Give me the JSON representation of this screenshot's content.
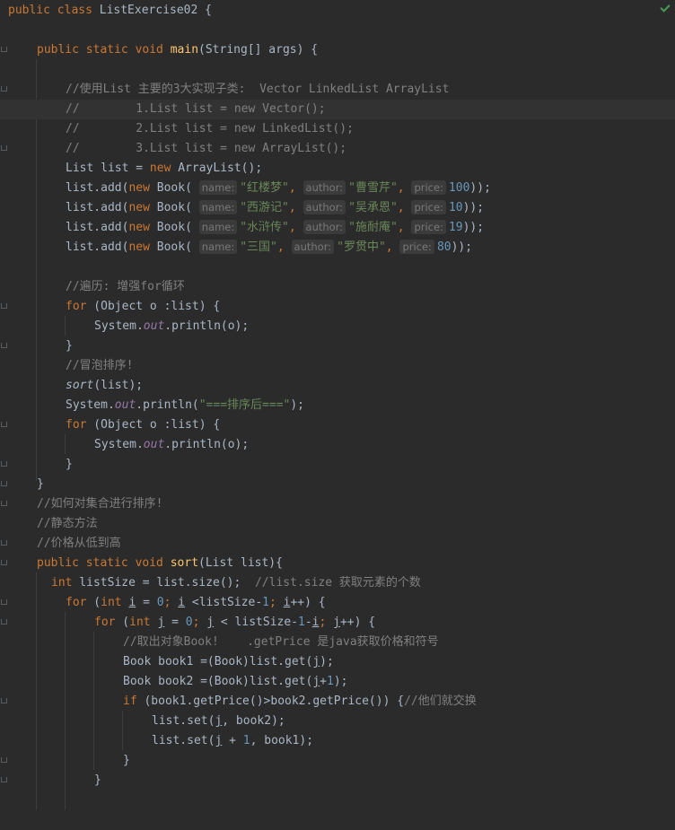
{
  "editor": {
    "inspection_status": "ok",
    "colors": {
      "background": "#2b2b2b",
      "keyword": "#cc7832",
      "method": "#ffc66d",
      "comment": "#808080",
      "string": "#6a8759",
      "number": "#6897bb",
      "field": "#9876aa",
      "text": "#a9b7c6"
    },
    "lines": [
      {
        "l1_kw": "public class ",
        "l1_name": "ListExercise02 {"
      },
      {
        "l3_kw": "public static void ",
        "l3_fn": "main",
        "l3_rest": "(String[] args) {"
      },
      {
        "l5": "//使用List 主要的3大实现子类:  Vector LinkedList ArrayList"
      },
      {
        "l6": "//        1.List list = new Vector();"
      },
      {
        "l7": "//        2.List list = new LinkedList();"
      },
      {
        "l8": "//        3.List list = new ArrayList();"
      }
    ],
    "l9_a": "List list = ",
    "l9_kw": "new",
    "l9_b": " ArrayList();",
    "books": [
      {
        "name": "\"红楼梦\"",
        "author": "\"曹雪芹\"",
        "price": "100"
      },
      {
        "name": "\"西游记\"",
        "author": "\"吴承恩\"",
        "price": "10"
      },
      {
        "name": "\"水浒传\"",
        "author": "\"施耐庵\"",
        "price": "19"
      },
      {
        "name": "\"三国\"",
        "author": "\"罗贯中\"",
        "price": "80"
      }
    ],
    "hint_name": "name:",
    "hint_author": "author:",
    "hint_price": "price:",
    "add_prefix": "list.add(",
    "add_new": "new",
    "add_book": " Book( ",
    "add_end": "));",
    "comma": ", ",
    "c_traverse": "//遍历: 增强for循环",
    "for_kw": "for",
    "for_obj": " (Object o :list) {",
    "sys": "System.",
    "out": "out",
    "println_o": ".println(o);",
    "close": "}",
    "c_bubble": "//冒泡排序!",
    "sort_call": "sort",
    "sort_args": "(list);",
    "println_open": ".println(",
    "sorted_str": "\"===排序后===\"",
    "paren_semi": ");",
    "c_how": "//如何对集合进行排序!",
    "c_static": "//静态方法",
    "c_price": "//价格从低到高",
    "sort_decl_kw": "public static void ",
    "sort_decl_fn": "sort",
    "sort_decl_rest": "(List list){",
    "int_kw": "int",
    "listsize_a": " listSize = list.size();  ",
    "listsize_c": "//list.size 获取元素的个数",
    "for_int_open": " (",
    "var_i": "i",
    "eq0": " = ",
    "zero": "0",
    "semi_sp": "; ",
    "lt_ls_minus": " <listSize-",
    "one": "1",
    "inc": "++) {",
    "var_j": "j",
    "lt_j": " < listSize-",
    "minus": "-",
    "c_take": "//取出对象Book!    .getPrice 是java获取价格和符号",
    "book1_a": "Book book1 =(Book)list.get(",
    "book1_b": ");",
    "book2_a": "Book book2 =(Book)list.get(",
    "plus": "+",
    "book2_b": ");",
    "if_kw": "if",
    "if_rest": " (book1.getPrice()>book2.getPrice()) {",
    "c_swap": "//他们就交换",
    "set1_a": "list.set(",
    "set1_b": ", book2);",
    "set2_a": "list.set(",
    "set2_plus": " + ",
    "set2_b": ", book1);"
  }
}
